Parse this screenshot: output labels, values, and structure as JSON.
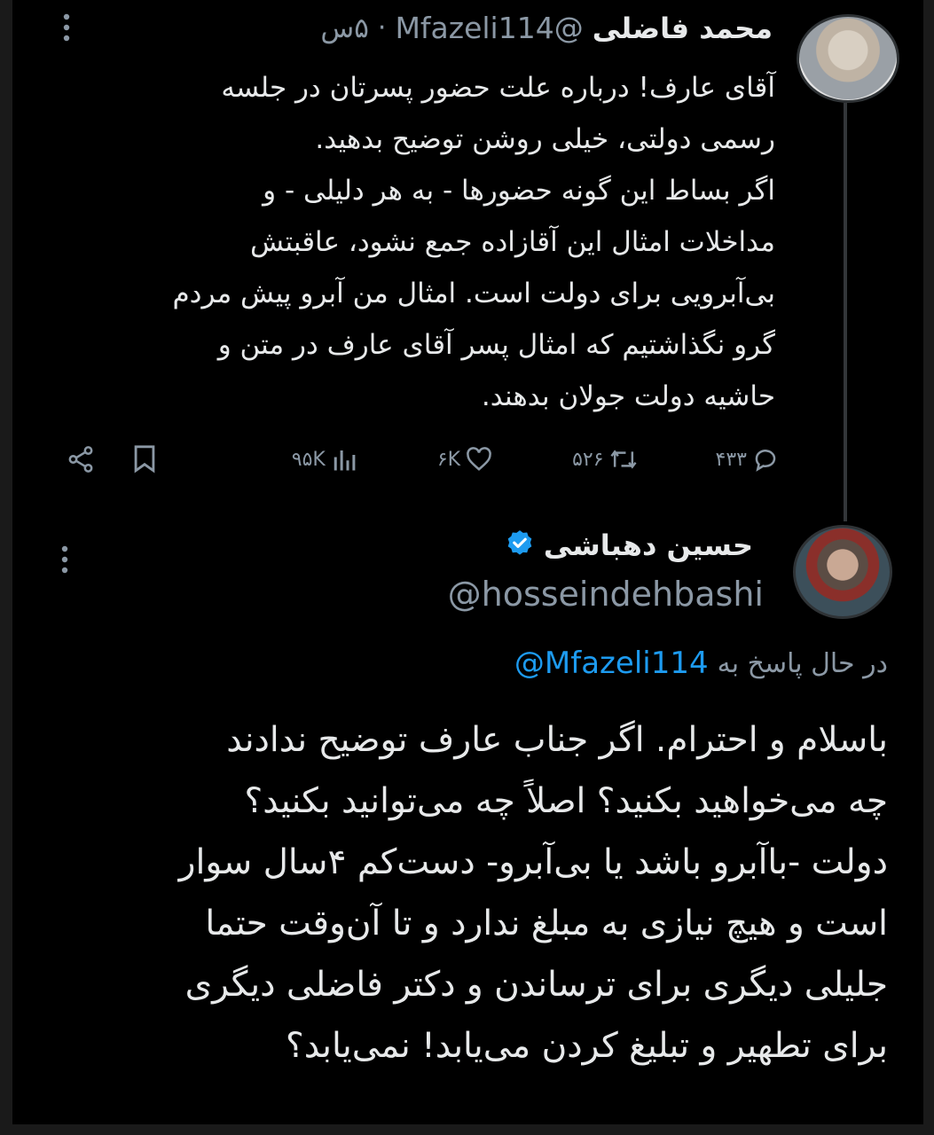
{
  "tweet1": {
    "name": "محمد فاضلی",
    "handle": "@Mfazeli114",
    "separator": "·",
    "time": "۵س",
    "more_icon": "more-vertical-icon",
    "body_lines": [
      "آقای عارف! درباره علت حضور پسرتان در  جلسه",
      "رسمی دولتی، خیلی روشن توضیح بدهید.",
      "اگر بساط این گونه حضورها - به هر دلیلی - و",
      "مداخلات امثال این آقازاده جمع نشود، عاقبتش",
      "بی‌آبرویی برای دولت است. امثال من آبرو پیش مردم",
      "گرو نگذاشتیم که امثال پسر آقای عارف در متن و",
      "حاشیه دولت جولان بدهند."
    ],
    "actions": {
      "replies": "۴۳۳",
      "reposts": "۵۲۶",
      "likes": "۶K",
      "views": "۹۵K"
    }
  },
  "tweet2": {
    "name": "حسین دهباشی",
    "verified_icon": "verified-badge-icon",
    "handle": "@hosseindehbashi",
    "more_icon": "more-vertical-icon",
    "reply_prefix": "در حال پاسخ به",
    "reply_handle": "@Mfazeli114",
    "body_lines": [
      "باسلام و احترام. اگر جناب عارف توضیح ندادند",
      "چه می‌خواهید بکنید؟ اصلاً چه می‌توانید بکنید؟",
      "دولت -باآبرو باشد یا بی‌آبرو- دست‌کم ۴سال سوار",
      "است و هیچ نیازی به مبلغ ندارد و تا آن‌وقت حتما",
      "جلیلی دیگری برای ترساندن و دکتر فاضلی دیگری",
      "برای تطهیر و تبلیغ کردن می‌یابد! نمی‌یابد؟"
    ]
  },
  "colors": {
    "background": "#000000",
    "text": "#e7e9ea",
    "muted": "#8b98a5",
    "link": "#1d9bf0",
    "verified": "#1d9bf0"
  }
}
